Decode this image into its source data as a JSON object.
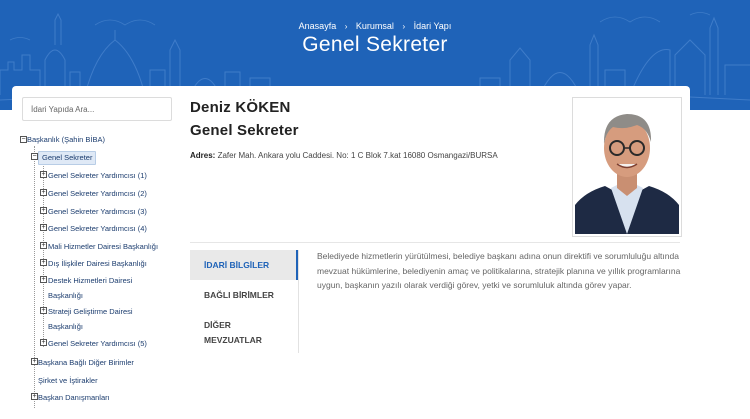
{
  "breadcrumb": {
    "items": [
      "Anasayfa",
      "Kurumsal",
      "İdari Yapı"
    ]
  },
  "page": {
    "title": "Genel Sekreter"
  },
  "search": {
    "placeholder": "İdari Yapıda Ara..."
  },
  "tree": {
    "root": "Başkanlık (Şahin BİBA)",
    "selected": "Genel Sekreter",
    "children": [
      "Genel Sekreter Yardımcısı (1)",
      "Genel Sekreter Yardımcısı (2)",
      "Genel Sekreter Yardımcısı (3)",
      "Genel Sekreter Yardımcısı (4)",
      "Mali Hizmetler Dairesi Başkanlığı",
      "Dış İlişkiler Dairesi Başkanlığı",
      "Destek Hizmetleri Dairesi",
      "Başkanlığı",
      "Strateji Geliştirme Dairesi",
      "Başkanlığı",
      "Genel Sekreter Yardımcısı (5)"
    ],
    "top_level": [
      "Başkana Bağlı Diğer Birimler",
      "Şirket ve İştirakler",
      "Başkan Danışmanları"
    ]
  },
  "person": {
    "name": "Deniz KÖKEN",
    "title": "Genel Sekreter",
    "address_label": "Adres:",
    "address": "Zafer Mah. Ankara yolu Caddesi. No: 1 C Blok 7.kat 16080 Osmangazi/BURSA"
  },
  "tabs": [
    {
      "label": "İDARİ BİLGİLER",
      "active": true
    },
    {
      "label": "BAĞLI BİRİMLER",
      "active": false
    },
    {
      "label": "DİĞER",
      "active": false
    },
    {
      "label": "MEVZUATLAR",
      "active": false
    }
  ],
  "tab_content": "Belediyede hizmetlerin yürütülmesi, belediye başkanı adına onun direktifi ve sorumluluğu altında mevzuat hükümlerine, belediyenin amaç ve politikalarına, stratejik planına ve yıllık programlarına uygun, başkanın yazılı olarak verdiği görev, yetki ve sorumluluk altında görev yapar.",
  "colors": {
    "hero_blue": "#1f63b8",
    "active_tab": "#1f63b8",
    "tree_text": "#1b3c6e"
  }
}
